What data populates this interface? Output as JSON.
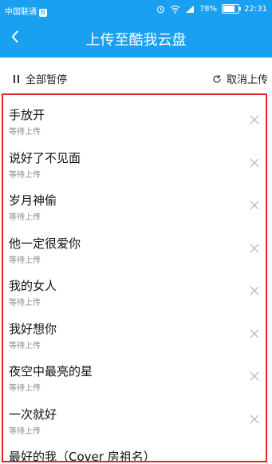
{
  "status_bar": {
    "carrier": "中国联通",
    "carrier_badge": "B",
    "battery": "78%",
    "battery_level": 0.78,
    "time": "22:31"
  },
  "header": {
    "title": "上传至酷我云盘"
  },
  "toolbar": {
    "pause_all": "全部暂停",
    "cancel_upload": "取消上传"
  },
  "items": [
    {
      "name": "手放开",
      "status": "等待上传"
    },
    {
      "name": "说好了不见面",
      "status": "等待上传"
    },
    {
      "name": "岁月神偷",
      "status": "等待上传"
    },
    {
      "name": "他一定很爱你",
      "status": "等待上传"
    },
    {
      "name": "我的女人",
      "status": "等待上传"
    },
    {
      "name": "我好想你",
      "status": "等待上传"
    },
    {
      "name": "夜空中最亮的星",
      "status": "等待上传"
    },
    {
      "name": "一次就好",
      "status": "等待上传"
    },
    {
      "name": "最好的我（Cover 房祖名）",
      "status": ""
    }
  ],
  "colors": {
    "brand": "#1aa0f0",
    "highlight": "#e3262b"
  }
}
